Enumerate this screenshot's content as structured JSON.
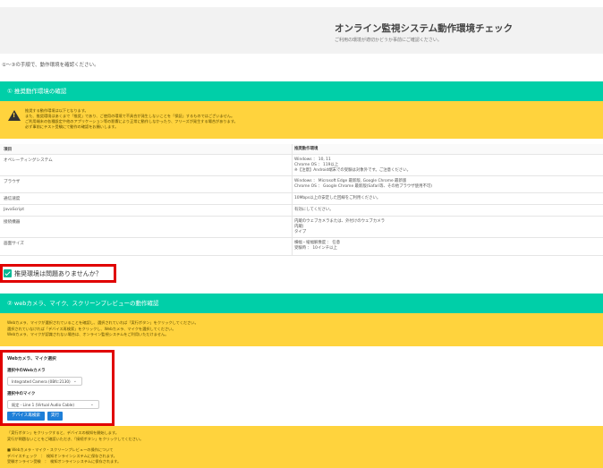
{
  "header": {
    "title": "オンライン監視システム動作環境チェック",
    "subtitle": "ご利用の環境が適切かどうか事前にご確認ください。"
  },
  "intro": "①〜③の手順で、動作環境を確認ください。",
  "section1": {
    "title": "① 推奨動作環境の確認",
    "warning_icon": "warning-triangle-icon",
    "warning_lines": [
      "推奨する動作環境は以下となります。",
      "また、推奨環境はあくまで「推奨」であり、ご使用の環境で不具合が発生しないことを「保証」するものではございません。",
      "ご利用端末の各種設定や他のアプリケーション等の影響により正常に動作しなかったり、フリーズが発生する場合があります。",
      "必ず事前にテスト受験にて動作の確認をお願いします。"
    ]
  },
  "env_table": {
    "headers": [
      "項目",
      "推奨動作環境"
    ],
    "rows": [
      {
        "item": "オペレーティングシステム",
        "env": [
          "Windows ： 10, 11",
          "Chrome OS ： 119以上",
          "※【注意】Android端末での受験は対象外です。ご注意ください。"
        ]
      },
      {
        "item": "ブラウザ",
        "env": [
          "Windows ： Microsoft Edge 最新版, Google Chrome 最新版",
          "Chrome OS ： Google Chrome 最新版(Safari等、その他ブラウザ使用不可)"
        ]
      },
      {
        "item": "通信速度",
        "env": [
          "10Mbps以上の安定した回線をご利用ください。"
        ]
      },
      {
        "item": "JavaScript",
        "env": [
          "有効にしてください。"
        ]
      },
      {
        "item": "接続機器",
        "env": [
          "内蔵のウェブカメラまたは、外付けのウェブカメラ",
          "内蔵(",
          "タイプ"
        ]
      },
      {
        "item": "画面サイズ",
        "env": [
          "横幅・縦幅解像度 ： 任意",
          "受験時 ： 10インチ以上"
        ]
      }
    ]
  },
  "confirm_check": {
    "label": "推奨環境は問題ありませんか？",
    "checked": true
  },
  "section2": {
    "title": "② webカメラ、マイク、スクリーンプレビューの動作確認",
    "info_lines": [
      "Webカメラ、マイクが選択されていることを確認し、選択されていれば「実行ボタン」をクリックしてください。",
      "選択されていなければ「デバイス再検索」をクリックし、Webカメラ、マイクを選択してください。",
      "Webカメラ、マイクが認識されない場合は、オンライン監視システムをご利用いただけません。"
    ]
  },
  "device_panel": {
    "title": "Webカメラ、マイク選択",
    "camera_label": "選択中のWebカメラ",
    "camera_value": "Integrated Camera (0Bfc:2130)",
    "mic_label": "選択中のマイク",
    "mic_value": "既定 - Line 1 (Virtual Audio Cable)",
    "rescan_button": "デバイス再検索",
    "run_button": "実行"
  },
  "bottom_info": {
    "lines": [
      "「実行ボタン」をクリックすると、デバイスの検知を開始します。",
      "実行が問題ないことをご確認いただき、「接続ボタン」をクリックしてください。"
    ],
    "lines2": [
      "■ Webカメラ・マイク・スクリーンプレビューの操作について",
      "デバイスチェック　：　検知オンラインシステムに保存されます。",
      "受験オンライン受験　：　検知オンラインシステムに保存されます。"
    ]
  }
}
